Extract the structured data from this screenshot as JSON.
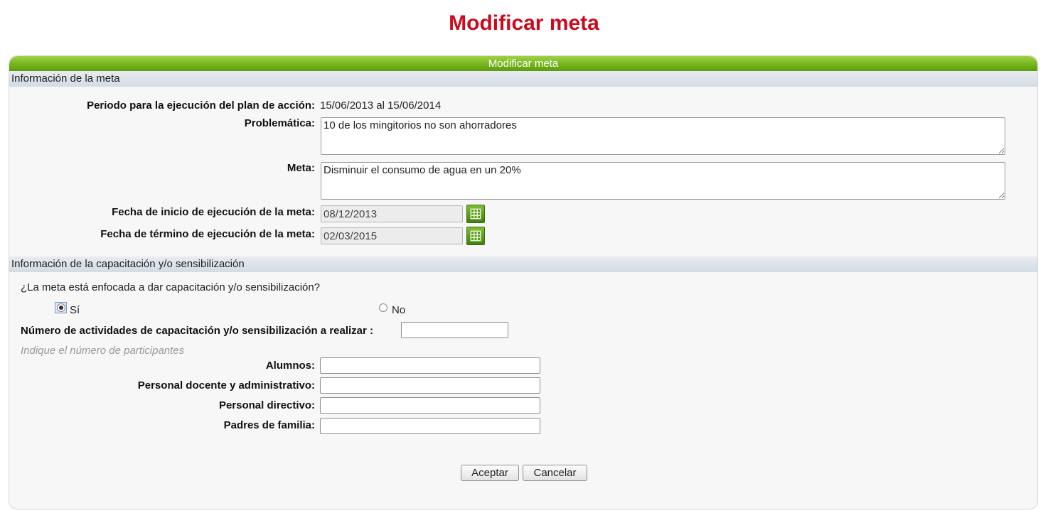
{
  "page": {
    "title": "Modificar meta"
  },
  "panel": {
    "header": "Modificar meta"
  },
  "section_meta": {
    "title": "Información de la meta",
    "periodo_label": "Periodo para la ejecución del plan de acción:",
    "periodo_value": "15/06/2013 al 15/06/2014",
    "problematica_label": "Problemática:",
    "problematica_value": "10 de los mingitorios no son ahorradores",
    "meta_label": "Meta:",
    "meta_value": "Disminuir el consumo de agua en un 20%",
    "fecha_inicio_label": "Fecha de inicio de ejecución de la meta:",
    "fecha_inicio_value": "08/12/2013",
    "fecha_termino_label": "Fecha de término de ejecución de la meta:",
    "fecha_termino_value": "02/03/2015",
    "calendar_icon": "calendar-icon"
  },
  "section_capacitacion": {
    "title": "Información de la capacitación y/o sensibilización",
    "question": "¿La meta está enfocada a dar capacitación y/o sensibilización?",
    "option_si": "Sí",
    "option_no": "No",
    "selected": "Sí",
    "num_actividades_label": "Número de actividades de capacitación y/o sensibilización a realizar :",
    "num_actividades_value": "",
    "participantes_hint": "Indique el número de participantes",
    "alumnos_label": "Alumnos:",
    "docente_label": "Personal docente y administrativo:",
    "directivo_label": "Personal directivo:",
    "padres_label": "Padres de familia:"
  },
  "buttons": {
    "aceptar": "Aceptar",
    "cancelar": "Cancelar"
  }
}
